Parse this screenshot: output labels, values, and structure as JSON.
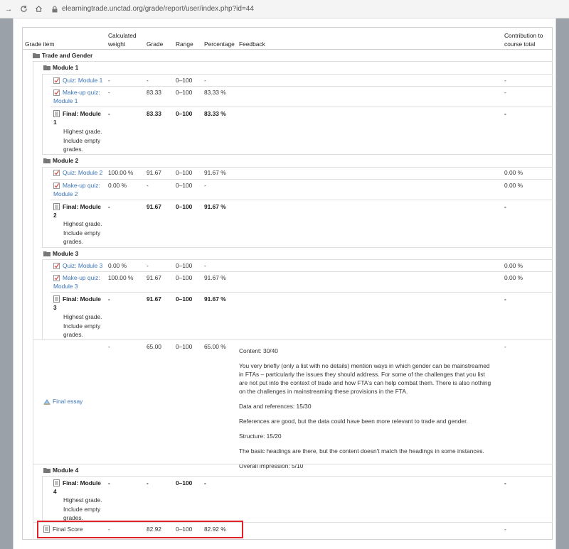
{
  "browser": {
    "url": "elearningtrade.unctad.org/grade/report/user/index.php?id=44"
  },
  "headers": {
    "item": "Grade item",
    "weight_1": "Calculated",
    "weight_2": "weight",
    "grade": "Grade",
    "range": "Range",
    "percentage": "Percentage",
    "feedback": "Feedback",
    "contribution_1": "Contribution to",
    "contribution_2": "course total"
  },
  "course": "Trade and Gender",
  "module1": {
    "title": "Module 1",
    "quiz": {
      "name": "Quiz: Module 1",
      "weight": "-",
      "grade": "-",
      "range": "0–100",
      "pct": "-",
      "contrib": "-"
    },
    "makeup": {
      "name1": "Make-up quiz:",
      "name2": "Module 1",
      "weight": "-",
      "grade": "83.33",
      "range": "0–100",
      "pct": "83.33 %",
      "contrib": "-"
    },
    "final": {
      "name1": "Final: Module",
      "name2": "1",
      "weight": "-",
      "grade": "83.33",
      "range": "0–100",
      "pct": "83.33 %",
      "contrib": "-",
      "note1": "Highest grade.",
      "note2": "Include empty",
      "note3": "grades."
    }
  },
  "module2": {
    "title": "Module 2",
    "quiz": {
      "name": "Quiz: Module 2",
      "weight": "100.00 %",
      "grade": "91.67",
      "range": "0–100",
      "pct": "91.67 %",
      "contrib": "0.00 %"
    },
    "makeup": {
      "name1": "Make-up quiz:",
      "name2": "Module 2",
      "weight": "0.00 %",
      "grade": "-",
      "range": "0–100",
      "pct": "-",
      "contrib": "0.00 %"
    },
    "final": {
      "name1": "Final: Module",
      "name2": "2",
      "weight": "-",
      "grade": "91.67",
      "range": "0–100",
      "pct": "91.67 %",
      "contrib": "-",
      "note1": "Highest grade.",
      "note2": "Include empty",
      "note3": "grades."
    }
  },
  "module3": {
    "title": "Module 3",
    "quiz": {
      "name": "Quiz: Module 3",
      "weight": "0.00 %",
      "grade": "-",
      "range": "0–100",
      "pct": "-",
      "contrib": "0.00 %"
    },
    "makeup": {
      "name1": "Make-up quiz:",
      "name2": "Module 3",
      "weight": "100.00 %",
      "grade": "91.67",
      "range": "0–100",
      "pct": "91.67 %",
      "contrib": "0.00 %"
    },
    "final": {
      "name1": "Final: Module",
      "name2": "3",
      "weight": "-",
      "grade": "91.67",
      "range": "0–100",
      "pct": "91.67 %",
      "contrib": "-",
      "note1": "Highest grade.",
      "note2": "Include empty",
      "note3": "grades."
    }
  },
  "essay": {
    "name": "Final essay",
    "weight": "-",
    "grade": "65.00",
    "range": "0–100",
    "pct": "65.00 %",
    "contrib": "-",
    "feedback": [
      "Content: 30/40",
      "You very briefly (only a list with no details) mention ways in which gender can be mainstreamed in FTAs – particularly the issues they should address. For some of the challenges that you list are not put into the context of trade and how FTA's can help combat them. There is also nothing on the challenges in mainstreaming these provisions in the FTA.",
      "Data and references: 15/30",
      "References are good, but the data could have been more relevant to trade and gender.",
      "Structure: 15/20",
      "The basic headings are there, but the content doesn't match the headings in some instances.",
      "Overall impression: 5/10"
    ]
  },
  "module4": {
    "title": "Module 4",
    "final": {
      "name1": "Final: Module",
      "name2": "4",
      "weight": "-",
      "grade": "-",
      "range": "0–100",
      "pct": "-",
      "contrib": "-",
      "note1": "Highest grade.",
      "note2": "Include empty",
      "note3": "grades."
    }
  },
  "final_score": {
    "name": "Final Score",
    "weight": "-",
    "grade": "82.92",
    "range": "0–100",
    "pct": "82.92 %",
    "contrib": "-"
  },
  "colors": {
    "link": "#3b73b6",
    "highlight": "#e2202a"
  }
}
